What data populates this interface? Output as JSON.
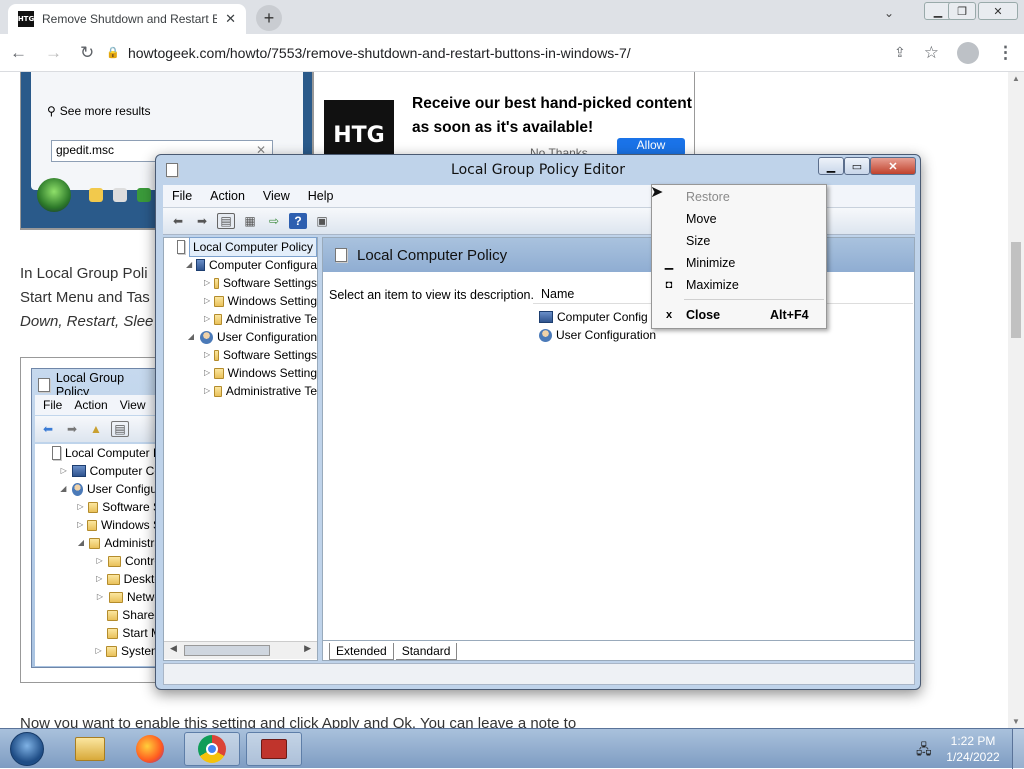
{
  "browser": {
    "tab_title": "Remove Shutdown and Restart B",
    "favicon_text": "HTG",
    "url": "howtogeek.com/howto/7553/remove-shutdown-and-restart-buttons-in-windows-7/"
  },
  "article": {
    "start_menu": {
      "see_more": "See more results",
      "search_value": "gpedit.msc"
    },
    "promo": {
      "logo": "HTG",
      "text": "Receive our best hand-picked content as soon as it's available!",
      "no_thanks": "No Thanks",
      "allow": "Allow"
    },
    "para_line1": "In Local Group Poli",
    "para_line2": "Start Menu and Tas",
    "para_line3": "Down, Restart, Slee",
    "bottom_text": "Now you want to enable this setting and click Apply and Ok. You can leave a note to",
    "screenshot2": {
      "title": "Local Group Policy",
      "menu": [
        "File",
        "Action",
        "View"
      ],
      "tree": [
        {
          "label": "Local Computer P",
          "icon": "doc",
          "arrow": "",
          "indent": 0
        },
        {
          "label": "Computer Co",
          "icon": "pc",
          "arrow": "▷",
          "indent": 1
        },
        {
          "label": "User Configur",
          "icon": "usr",
          "arrow": "◢",
          "indent": 1
        },
        {
          "label": "Software S",
          "icon": "folder",
          "arrow": "▷",
          "indent": 2
        },
        {
          "label": "Windows S",
          "icon": "folder",
          "arrow": "▷",
          "indent": 2
        },
        {
          "label": "Administra",
          "icon": "folder",
          "arrow": "◢",
          "indent": 2
        },
        {
          "label": "Contro",
          "icon": "folder",
          "arrow": "▷",
          "indent": 3
        },
        {
          "label": "Deskto",
          "icon": "folder",
          "arrow": "▷",
          "indent": 3
        },
        {
          "label": "Netwo",
          "icon": "folder",
          "arrow": "▷",
          "indent": 3
        },
        {
          "label": "Shared",
          "icon": "folder",
          "arrow": "",
          "indent": 3
        },
        {
          "label": "Start M",
          "icon": "folder",
          "arrow": "",
          "indent": 3
        },
        {
          "label": "System",
          "icon": "folder",
          "arrow": "▷",
          "indent": 3
        }
      ]
    }
  },
  "gpe": {
    "title": "Local Group Policy Editor",
    "menu": [
      "File",
      "Action",
      "View",
      "Help"
    ],
    "tree": [
      {
        "label": "Local Computer Policy",
        "icon": "doc",
        "arrow": "",
        "indent": 0,
        "selected": true
      },
      {
        "label": "Computer Configura",
        "icon": "pc",
        "arrow": "◢",
        "indent": 1
      },
      {
        "label": "Software Settings",
        "icon": "folder",
        "arrow": "▷",
        "indent": 2
      },
      {
        "label": "Windows Setting",
        "icon": "folder",
        "arrow": "▷",
        "indent": 2
      },
      {
        "label": "Administrative Te",
        "icon": "folder",
        "arrow": "▷",
        "indent": 2
      },
      {
        "label": "User Configuration",
        "icon": "usr",
        "arrow": "◢",
        "indent": 1
      },
      {
        "label": "Software Settings",
        "icon": "folder",
        "arrow": "▷",
        "indent": 2
      },
      {
        "label": "Windows Setting",
        "icon": "folder",
        "arrow": "▷",
        "indent": 2
      },
      {
        "label": "Administrative Te",
        "icon": "folder",
        "arrow": "▷",
        "indent": 2
      }
    ],
    "header": "Local Computer Policy",
    "description": "Select an item to view its description.",
    "column_name": "Name",
    "items": [
      {
        "label": "Computer Config",
        "icon": "pc"
      },
      {
        "label": "User Configuration",
        "icon": "usr"
      }
    ],
    "tabs": [
      "Extended",
      "Standard"
    ]
  },
  "context_menu": {
    "items": [
      {
        "label": "Restore",
        "glyph": "",
        "shortcut": "",
        "disabled": true,
        "bold": false
      },
      {
        "label": "Move",
        "glyph": "",
        "shortcut": "",
        "disabled": false,
        "bold": false
      },
      {
        "label": "Size",
        "glyph": "",
        "shortcut": "",
        "disabled": false,
        "bold": false
      },
      {
        "label": "Minimize",
        "glyph": "▁",
        "shortcut": "",
        "disabled": false,
        "bold": false
      },
      {
        "label": "Maximize",
        "glyph": "◘",
        "shortcut": "",
        "disabled": false,
        "bold": false
      },
      {
        "label": "Close",
        "glyph": "x",
        "shortcut": "Alt+F4",
        "disabled": false,
        "bold": true
      }
    ]
  },
  "taskbar": {
    "time": "1:22 PM",
    "date": "1/24/2022"
  },
  "colors": {
    "accent": "#1a73e8",
    "titlebar": "#bfd3ea",
    "taskbar": "#8aa6c9"
  }
}
